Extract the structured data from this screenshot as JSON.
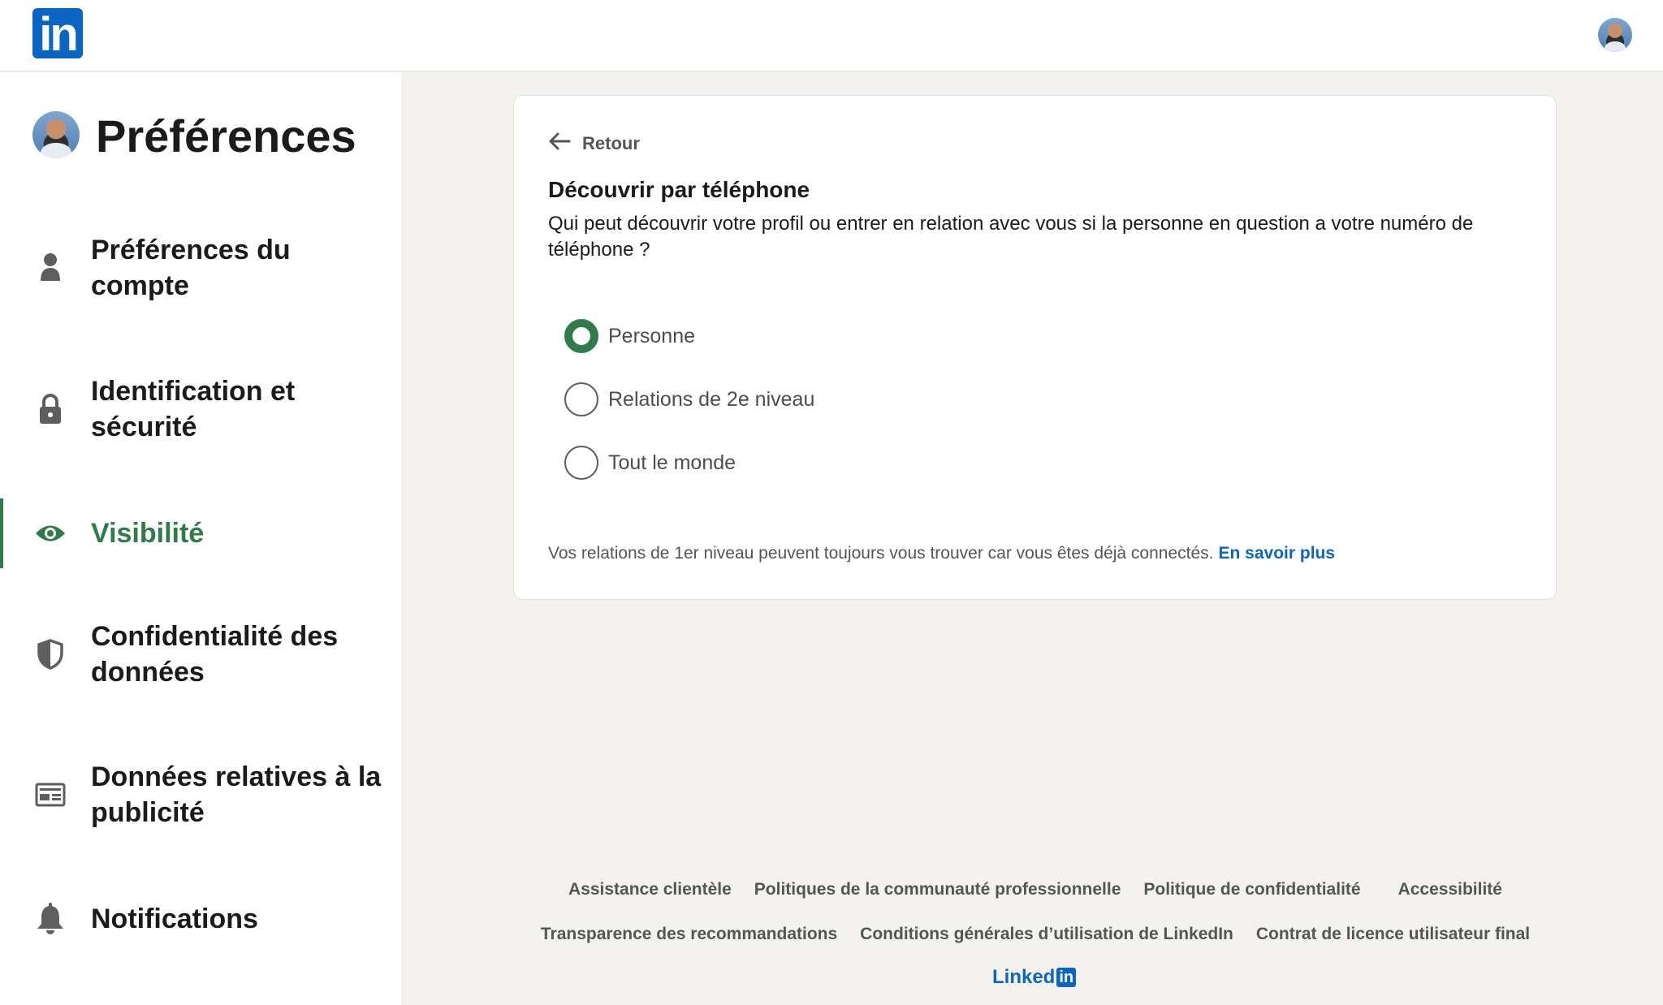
{
  "brand": {
    "logo_text": "in"
  },
  "sidebar": {
    "title": "Préférences",
    "items": [
      {
        "label": "Préférences du compte",
        "icon": "person-icon",
        "active": false
      },
      {
        "label": "Identification et sécurité",
        "icon": "lock-icon",
        "active": false
      },
      {
        "label": "Visibilité",
        "icon": "eye-icon",
        "active": true
      },
      {
        "label": "Confidentialité des données",
        "icon": "shield-icon",
        "active": false
      },
      {
        "label": "Données relatives à la publicité",
        "icon": "ad-card-icon",
        "active": false
      },
      {
        "label": "Notifications",
        "icon": "bell-icon",
        "active": false
      }
    ]
  },
  "panel": {
    "back_label": "Retour",
    "title": "Découvrir par téléphone",
    "question": "Qui peut découvrir votre profil ou entrer en relation avec vous si la personne en question a votre numéro de téléphone ?",
    "options": [
      {
        "label": "Personne",
        "selected": true
      },
      {
        "label": "Relations de 2e niveau",
        "selected": false
      },
      {
        "label": "Tout le monde",
        "selected": false
      }
    ],
    "note": "Vos relations de 1er niveau peuvent toujours vous trouver car vous êtes déjà connectés.",
    "note_link": "En savoir plus"
  },
  "footer": {
    "row1": [
      "Assistance clientèle",
      "Politiques de la communauté professionnelle",
      "Politique de confidentialité",
      "Accessibilité"
    ],
    "row2": [
      "Transparence des recommandations",
      "Conditions générales d’utilisation de LinkedIn",
      "Contrat de licence utilisateur final"
    ],
    "logo_text": "Linked",
    "logo_in": "in"
  },
  "colors": {
    "accent_green": "#2f7b4a",
    "link_blue": "#0a66c2",
    "background": "#f4f2ee"
  }
}
